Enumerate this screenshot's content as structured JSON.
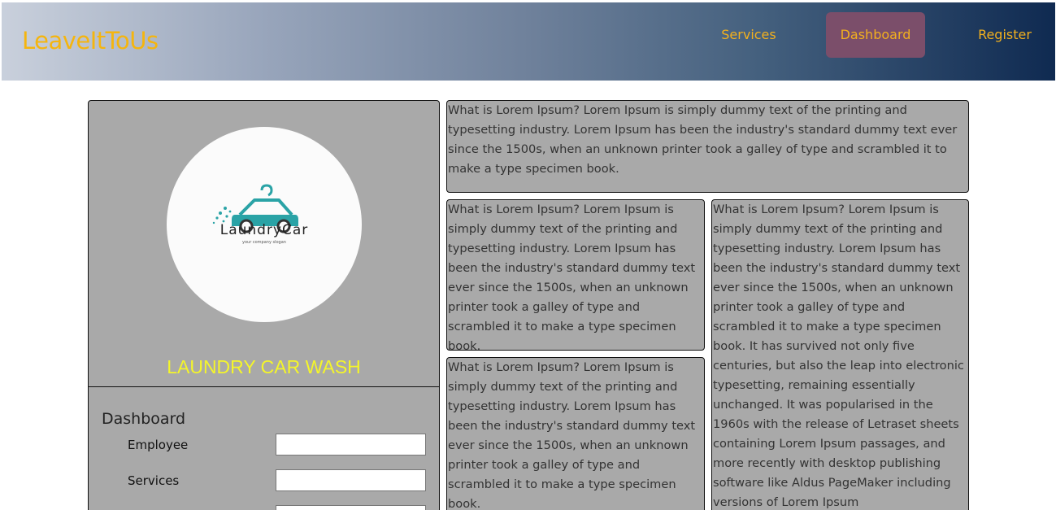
{
  "header": {
    "brand": "LeaveItToUs",
    "nav": {
      "services": "Services",
      "dashboard": "Dashboard",
      "register": "Register"
    },
    "colors": {
      "brand": "#f5b50e",
      "active_nav_bg": "#7b4e6a"
    }
  },
  "profile": {
    "logo_text": "LaundryCar",
    "logo_slogan": "your company slogan",
    "logo_icon": "car-hanger-icon",
    "company_name": "LAUNDRY CAR WASH"
  },
  "dashboard": {
    "title": "Dashboard",
    "employee_label": "Employee",
    "employee_value": "",
    "services_label": "Services",
    "services_value": ""
  },
  "content": {
    "top": "What is Lorem Ipsum? Lorem Ipsum is simply dummy text of the printing and typesetting industry. Lorem Ipsum has been the industry's standard dummy text ever since the 1500s, when an unknown printer took a galley of type and scrambled it to make a type specimen book.",
    "middle_left": "What is Lorem Ipsum? Lorem Ipsum is simply dummy text of the printing and typesetting industry. Lorem Ipsum has been the industry's standard dummy text ever since the 1500s, when an unknown printer took a galley of type and scrambled it to make a type specimen book.",
    "bottom_left": "What is Lorem Ipsum? Lorem Ipsum is simply dummy text of the printing and typesetting industry. Lorem Ipsum has been the industry's standard dummy text ever since the 1500s, when an unknown printer took a galley of type and scrambled it to make a type specimen book.",
    "right": "What is Lorem Ipsum? Lorem Ipsum is simply dummy text of the printing and typesetting industry. Lorem Ipsum has been the industry's standard dummy text ever since the 1500s, when an unknown printer took a galley of type and scrambled it to make a type specimen book. It has survived not only five centuries, but also the leap into electronic typesetting, remaining essentially unchanged. It was popularised in the 1960s with the release of Letraset sheets containing Lorem Ipsum passages, and more recently with desktop publishing software like Aldus PageMaker including versions of Lorem Ipsum"
  }
}
